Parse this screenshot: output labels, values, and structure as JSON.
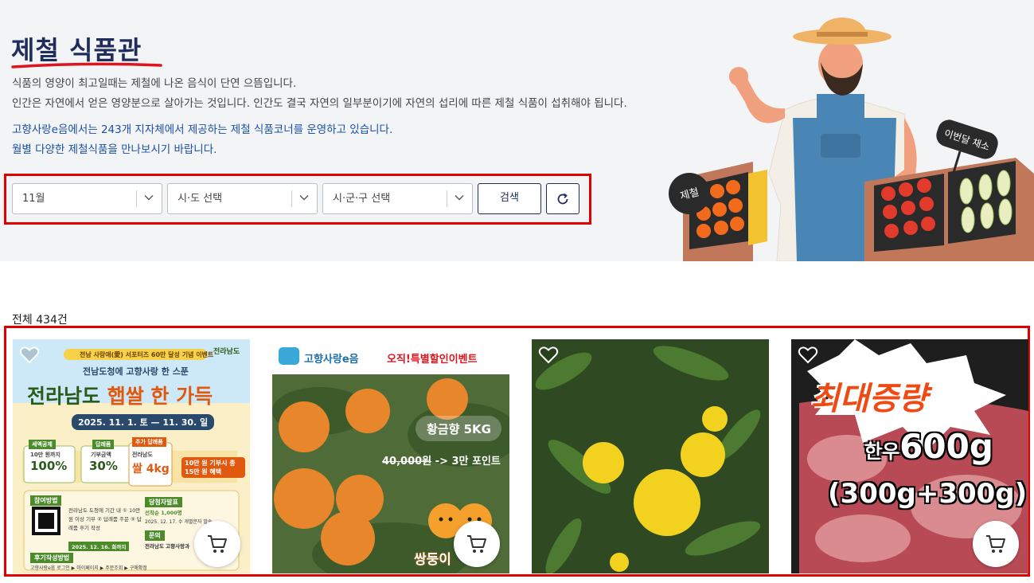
{
  "hero": {
    "title": "제철 식품관",
    "desc_line1": "식품의 영양이 최고일때는 제철에 나온 음식이 단연 으뜸입니다.",
    "desc_line2": "인간은 자연에서 얻은 영양분으로 살아가는 것입니다. 인간도 결국 자연의 일부분이기에 자연의 섭리에 따른 제철 식품이 섭취해야 됩니다.",
    "info_line1": "고향사랑e음에서는 243개 지자체에서 제공하는 제철 식품코너를 운영하고 있습니다.",
    "info_line2": "월별 다양한 제철식품을 만나보시기 바랍니다.",
    "illustration": {
      "sign_left": "제철",
      "sign_right": "이번달 채소"
    }
  },
  "filters": {
    "month": "11월",
    "province_placeholder": "시·도 선택",
    "district_placeholder": "시·군·구 선택",
    "search_label": "검색",
    "reset_icon": "refresh-icon"
  },
  "results": {
    "count_label": "전체 434건"
  },
  "products": [
    {
      "badge_top": "전남 사랑애(愛) 서포터즈 60만 달성 기념 이벤트",
      "org": "전라남도",
      "subtitle": "전남도청에 고향사랑 한 스푼",
      "headline_a": "전라남도 ",
      "headline_b": "햅쌀 한 가득",
      "period": "2025. 11. 1. 토 — 11. 30. 일",
      "chip1_title": "세액공제",
      "chip1_sub": "10만 원까지",
      "chip1_value": "100%",
      "chip2_title": "답례품",
      "chip2_sub": "기부금액",
      "chip2_value": "30%",
      "chip3_title": "추가 답례품",
      "chip3_sub": "전라남도",
      "chip3_value": "쌀 4kg",
      "bonus": "10만 원 기부시 총 15만 원 혜택",
      "how_title": "참여방법",
      "how_steps": "전라남도 도청에 기간 내 ① 10만원 이상 기부 ② 답례품 주문 ③ 답례품 후기 작성",
      "how_deadline": "2025. 12. 16. 화까지",
      "winner_title": "당첨자발표",
      "winner_count": "선착순 1,000명",
      "winner_date": "2025. 12. 17. 수 개별문자 발송",
      "contact_title": "문의",
      "contact_text": "전라남도 고향사랑과",
      "review_title": "후기작성방법",
      "review_text": "고향사랑e음 로그인 ▶ 마이페이지 ▶ 주문조회 ▶ 구매확정"
    },
    {
      "brand": "고향사랑e음",
      "event": "오직!특별할인이벤트",
      "name": "황금향 5KG",
      "old_price": "40,000원",
      "new_price": "-> 3만 포인트",
      "mascot": "쌍둥이"
    },
    {
      "photo": "tangerines-on-tree"
    },
    {
      "burst": "최대증량",
      "line1_a": "한우",
      "line1_b": "600g",
      "line2": "(300g+300g)"
    }
  ],
  "colors": {
    "title": "#1f2d5c",
    "underline": "#e0141e",
    "info_blue": "#1a4fa8",
    "highlight_border": "#e00000"
  }
}
